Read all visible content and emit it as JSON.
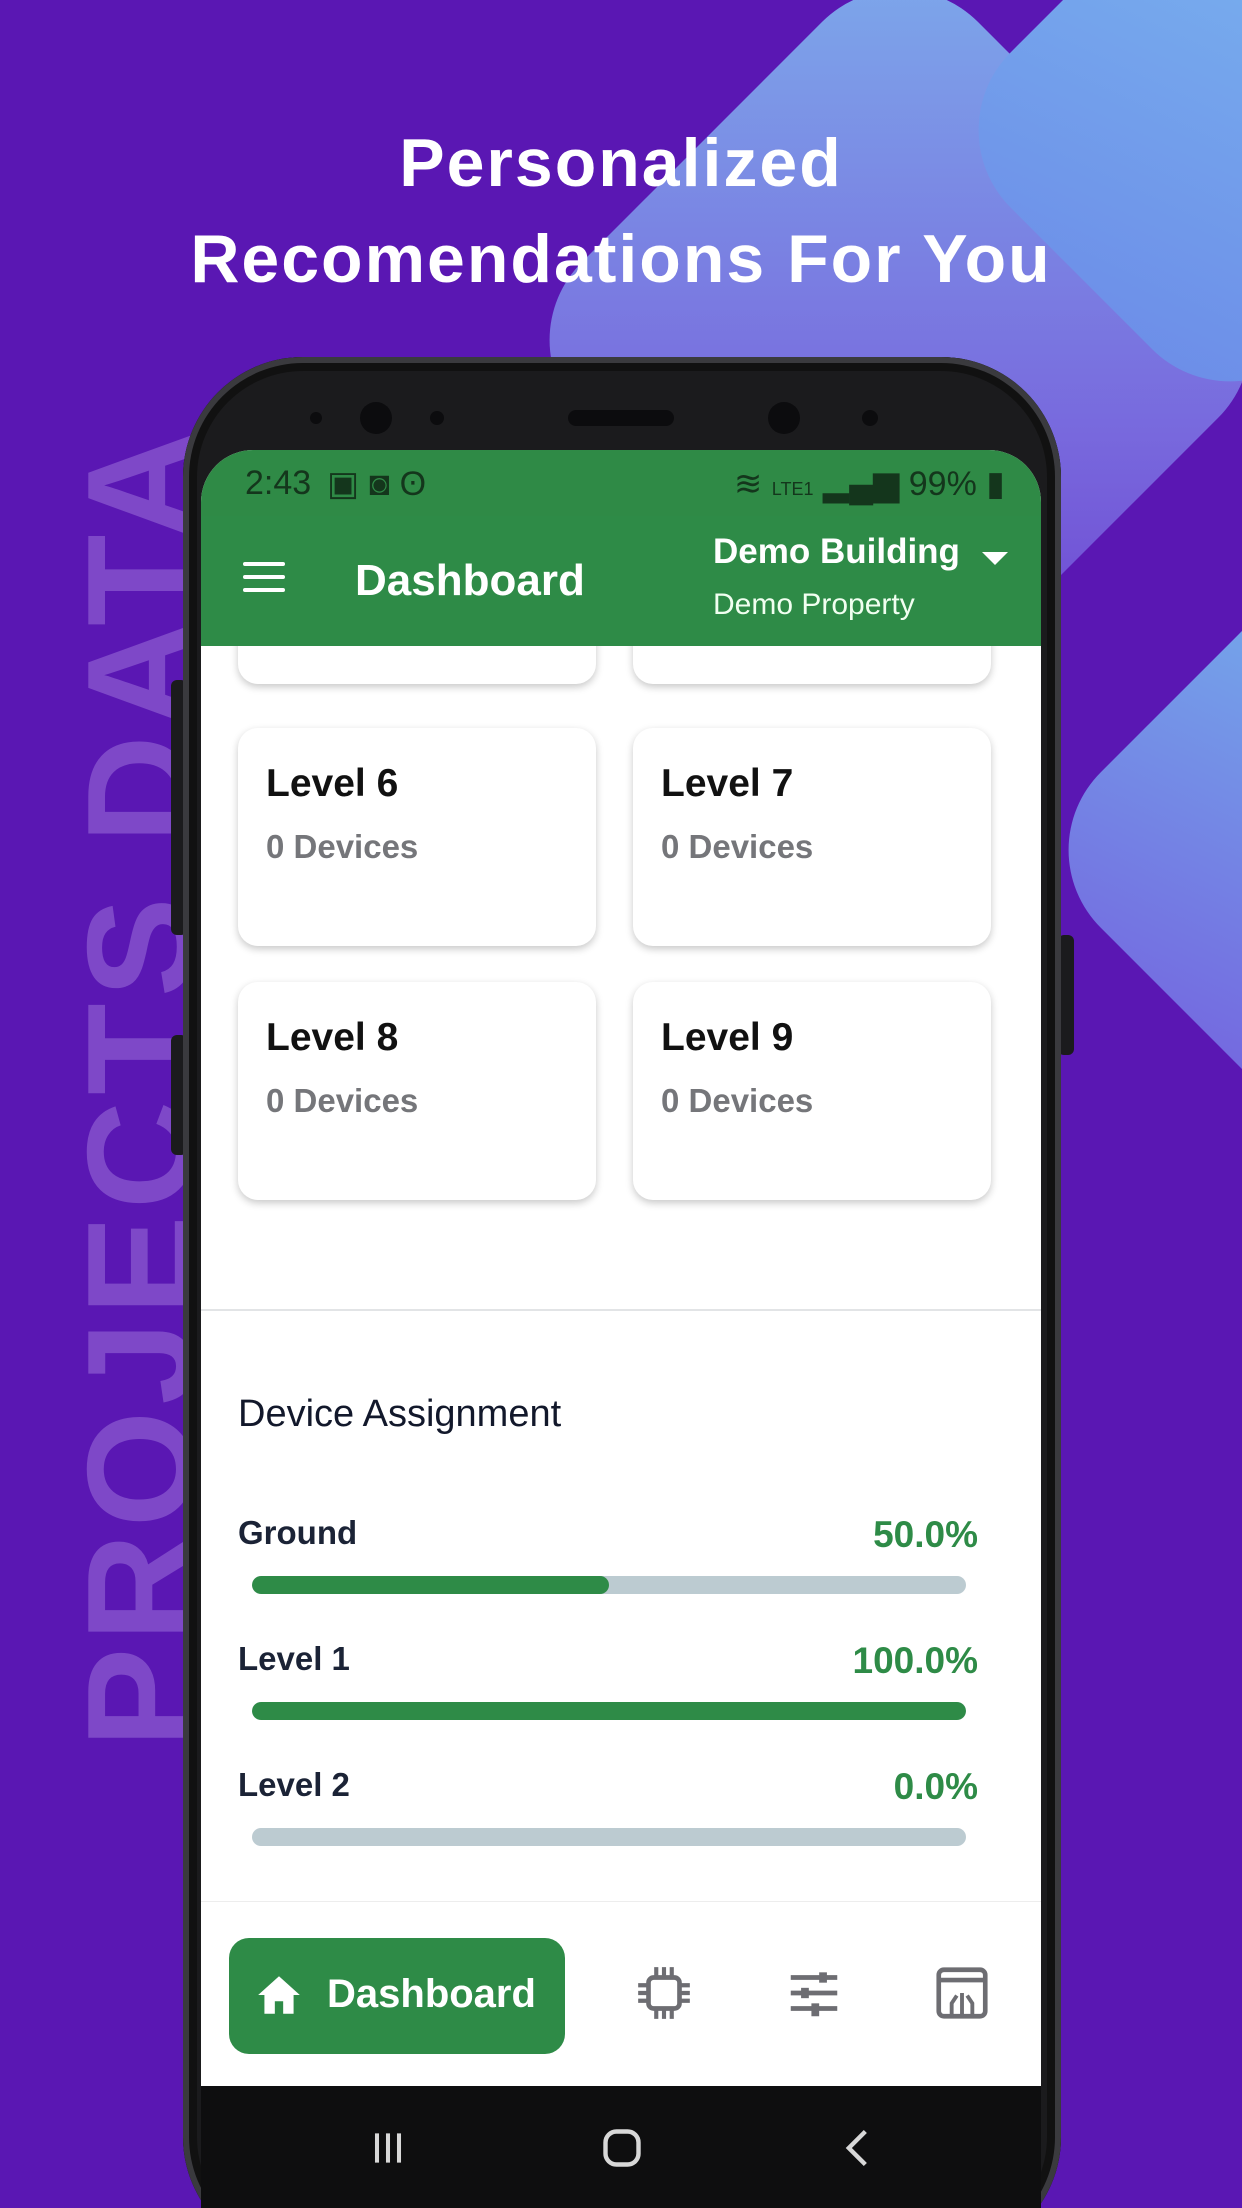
{
  "promo": {
    "headline_line1": "Personalized",
    "headline_line2": "Recomendations For You",
    "side_text": "PROJECTS DATA"
  },
  "status_bar": {
    "time": "2:43",
    "battery": "99%",
    "network": "LTE1"
  },
  "app_bar": {
    "title": "Dashboard",
    "building": "Demo Building",
    "property": "Demo Property"
  },
  "levels": [
    {
      "name": "Level 6",
      "devices": "0 Devices"
    },
    {
      "name": "Level 7",
      "devices": "0 Devices"
    },
    {
      "name": "Level 8",
      "devices": "0 Devices"
    },
    {
      "name": "Level 9",
      "devices": "0 Devices"
    }
  ],
  "device_assignment": {
    "title": "Device Assignment",
    "rows": [
      {
        "label": "Ground",
        "percent_text": "50.0%",
        "percent": 50
      },
      {
        "label": "Level 1",
        "percent_text": "100.0%",
        "percent": 100
      },
      {
        "label": "Level 2",
        "percent_text": "0.0%",
        "percent": 0
      }
    ]
  },
  "bottom_nav": {
    "active_label": "Dashboard",
    "icons": [
      "home-icon",
      "chip-icon",
      "sliders-icon",
      "circuit-board-icon"
    ]
  },
  "colors": {
    "background": "#5a17b3",
    "accent_green": "#2e8b47",
    "bar_track": "#bccbd1"
  }
}
